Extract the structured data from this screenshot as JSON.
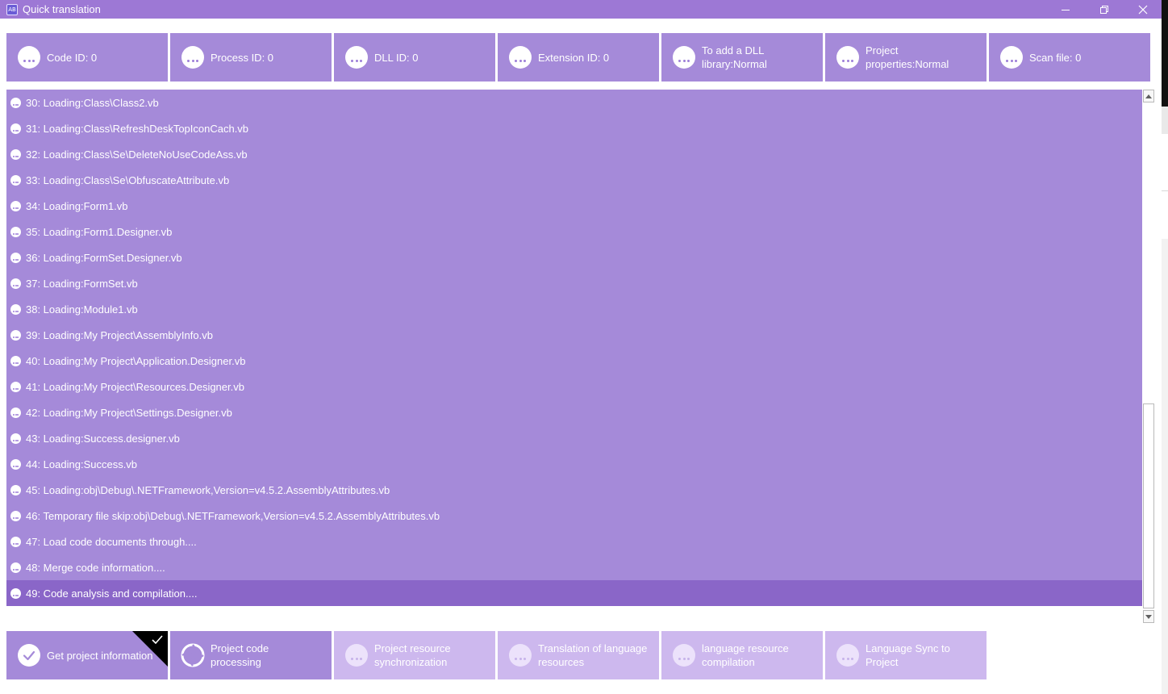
{
  "window": {
    "title": "Quick translation",
    "app_icon_text": "AB"
  },
  "stats": [
    {
      "label": "Code ID: 0"
    },
    {
      "label": "Process ID: 0"
    },
    {
      "label": "DLL ID: 0"
    },
    {
      "label": "Extension ID: 0"
    },
    {
      "label": "To add a DLL library:Normal"
    },
    {
      "label": "Project properties:Normal"
    },
    {
      "label": "Scan file: 0"
    }
  ],
  "log": {
    "rows": [
      "30: Loading:Class\\Class2.vb",
      "31: Loading:Class\\RefreshDeskTopIconCach.vb",
      "32: Loading:Class\\Se\\DeleteNoUseCodeAss.vb",
      "33: Loading:Class\\Se\\ObfuscateAttribute.vb",
      "34: Loading:Form1.vb",
      "35: Loading:Form1.Designer.vb",
      "36: Loading:FormSet.Designer.vb",
      "37: Loading:FormSet.vb",
      "38: Loading:Module1.vb",
      "39: Loading:My Project\\AssemblyInfo.vb",
      "40: Loading:My Project\\Application.Designer.vb",
      "41: Loading:My Project\\Resources.Designer.vb",
      "42: Loading:My Project\\Settings.Designer.vb",
      "43: Loading:Success.designer.vb",
      "44: Loading:Success.vb",
      "45: Loading:obj\\Debug\\.NETFramework,Version=v4.5.2.AssemblyAttributes.vb",
      "46: Temporary file skip:obj\\Debug\\.NETFramework,Version=v4.5.2.AssemblyAttributes.vb",
      "47: Load code documents through....",
      "48: Merge code information....",
      "49: Code analysis and compilation...."
    ],
    "selected_index": 19
  },
  "steps": [
    {
      "label": "Get project information",
      "state": "done"
    },
    {
      "label": "Project code processing",
      "state": "active"
    },
    {
      "label": "Project resource synchronization",
      "state": "pending"
    },
    {
      "label": "Translation of language resources",
      "state": "pending"
    },
    {
      "label": "language resource compilation",
      "state": "pending"
    },
    {
      "label": "Language Sync to Project",
      "state": "pending"
    }
  ],
  "colors": {
    "titlebar": "#9d78d5",
    "card": "#a58ad9",
    "selected_row": "#8a66c8",
    "pending_step": "#cdb8ee"
  },
  "icons": {
    "row": "more-dots-icon",
    "done_step": "check-circle-icon",
    "active_step": "spinner-icon",
    "pending_step": "more-dots-icon"
  }
}
